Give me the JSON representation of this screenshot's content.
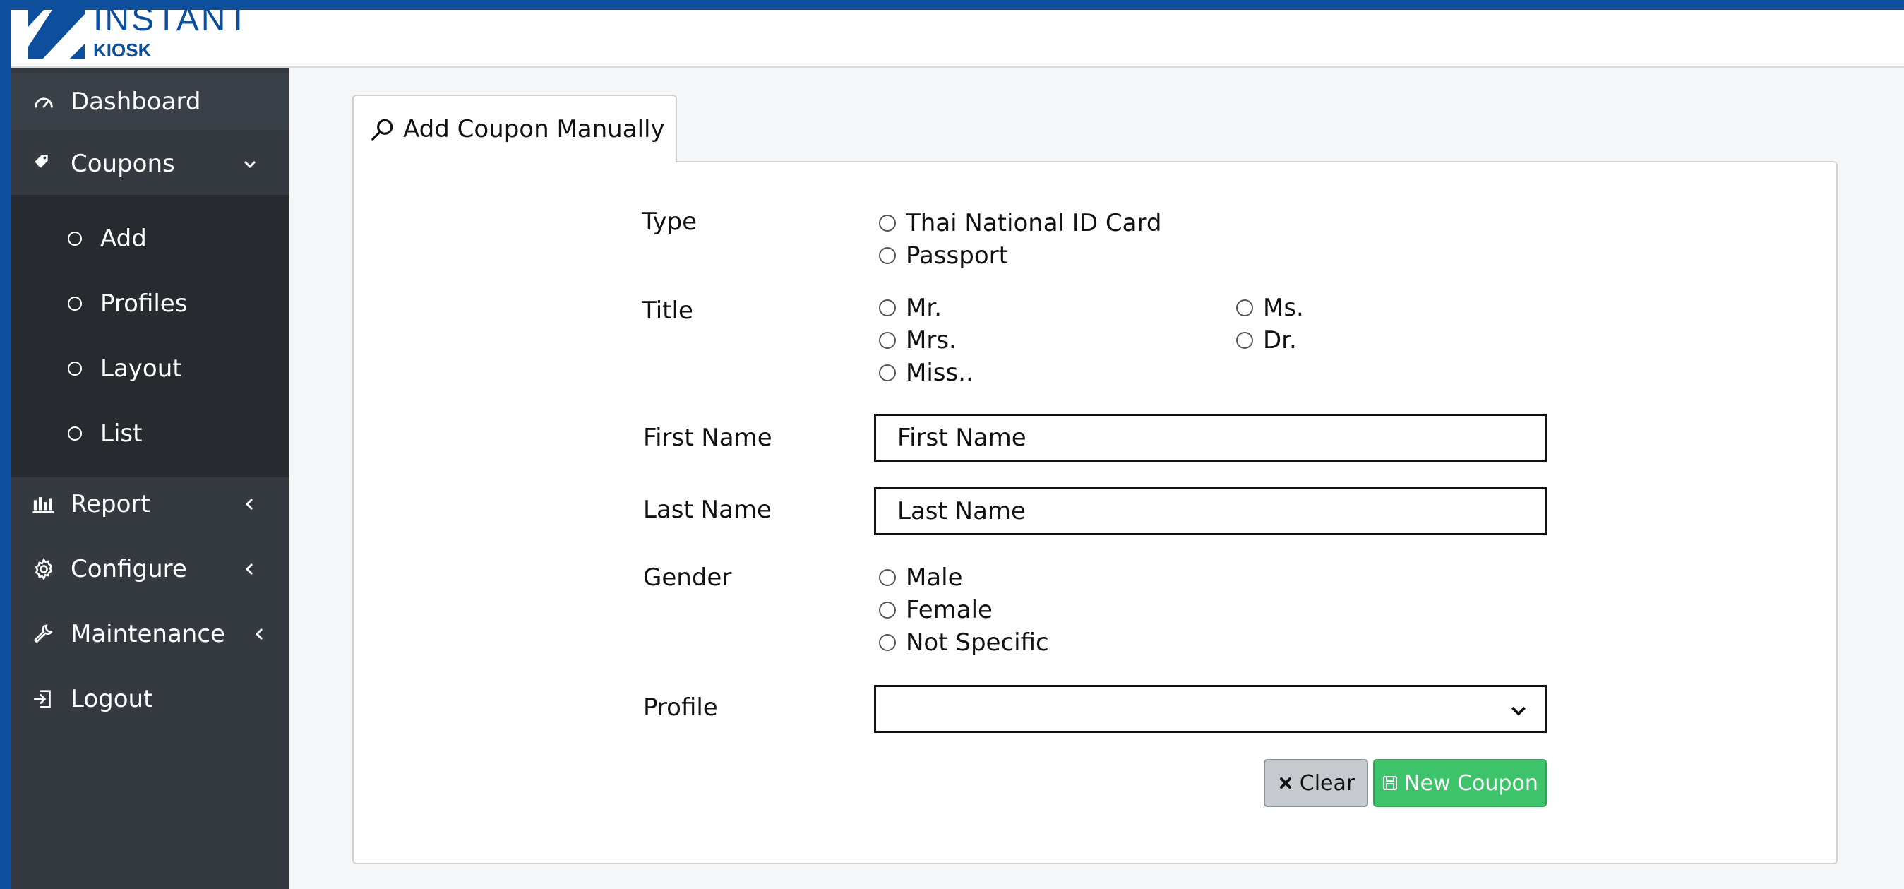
{
  "brand": {
    "name": "INSTANT",
    "sub": "KIOSK",
    "color": "#0d4f9c"
  },
  "sidebar": {
    "items": [
      {
        "label": "Dashboard",
        "icon": "gauge-icon"
      },
      {
        "label": "Coupons",
        "icon": "tags-icon",
        "expanded": true,
        "children": [
          "Add",
          "Profiles",
          "Layout",
          "List"
        ]
      },
      {
        "label": "Report",
        "icon": "bar-chart-icon"
      },
      {
        "label": "Configure",
        "icon": "gear-icon"
      },
      {
        "label": "Maintenance",
        "icon": "wrench-icon"
      },
      {
        "label": "Logout",
        "icon": "logout-icon"
      }
    ]
  },
  "tab": {
    "label": "Add Coupon Manually",
    "icon": "search-icon"
  },
  "form": {
    "type": {
      "label": "Type",
      "options": [
        "Thai National ID Card",
        "Passport"
      ]
    },
    "title": {
      "label": "Title",
      "options": [
        "Mr.",
        "Ms.",
        "Mrs.",
        "Dr.",
        "Miss.."
      ]
    },
    "first_name": {
      "label": "First Name",
      "placeholder": "First Name"
    },
    "last_name": {
      "label": "Last Name",
      "placeholder": "Last Name"
    },
    "gender": {
      "label": "Gender",
      "options": [
        "Male",
        "Female",
        "Not Specific"
      ]
    },
    "profile": {
      "label": "Profile",
      "value": ""
    },
    "buttons": {
      "clear": "Clear",
      "new_coupon": "New Coupon"
    }
  },
  "colors": {
    "sidebar_bg": "#343a40",
    "submenu_bg": "#272b30",
    "primary": "#0d4f9c",
    "success": "#3dc46b"
  }
}
